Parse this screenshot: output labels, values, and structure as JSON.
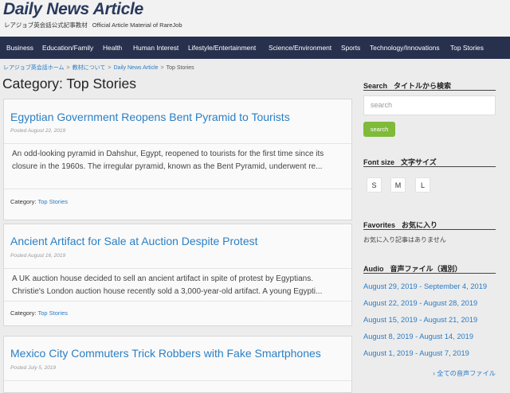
{
  "site": {
    "title": "Daily News Article",
    "subtitle_jp": "レアジョブ英会話公式記事教材",
    "subtitle_en": "Official Article Material of RareJob"
  },
  "nav": {
    "items": [
      "Business",
      "Education/Family",
      "Health",
      "Human Interest",
      "Lifestyle/Entertainment",
      "Science/Environment",
      "Sports",
      "Technology/Innovations",
      "Top Stories"
    ]
  },
  "breadcrumb": {
    "home": "レアジョブ英会話ホーム",
    "materials": "教材について",
    "dna": "Daily News Article",
    "current": "Top Stories",
    "separator": ">"
  },
  "page": {
    "title": "Category: Top Stories"
  },
  "articles": [
    {
      "title": "Egyptian Government Reopens Bent Pyramid to Tourists",
      "date": "Posted August 22, 2019",
      "excerpt": "An odd-looking pyramid in Dahshur, Egypt, reopened to tourists for the first time since its closure in the 1960s. The irregular pyramid, known as the Bent Pyramid, underwent re...",
      "category_label": "Category:",
      "category": "Top Stories"
    },
    {
      "title": "Ancient Artifact for Sale at Auction Despite Protest",
      "date": "Posted August 16, 2019",
      "excerpt": "A UK auction house decided to sell an ancient artifact in spite of protest by Egyptians. Christie's London auction house recently sold a 3,000-year-old artifact. A young Egypti...",
      "category_label": "Category:",
      "category": "Top Stories"
    },
    {
      "title": "Mexico City Commuters Trick Robbers with Fake Smartphones",
      "date": "Posted July 5, 2019"
    }
  ],
  "sidebar": {
    "search": {
      "heading_en": "Search",
      "heading_jp": "タイトルから検索",
      "placeholder": "search",
      "button": "search"
    },
    "fontsize": {
      "heading_en": "Font size",
      "heading_jp": "文字サイズ",
      "options": [
        "S",
        "M",
        "L"
      ]
    },
    "favorites": {
      "heading_en": "Favorites",
      "heading_jp": "お気に入り",
      "empty": "お気に入り記事はありません"
    },
    "audio": {
      "heading_en": "Audio",
      "heading_jp": "音声ファイル（週別）",
      "links": [
        "August 29, 2019 - September 4, 2019",
        "August 22, 2019 - August 28, 2019",
        "August 15, 2019 - August 21, 2019",
        "August 8, 2019 - August 14, 2019",
        "August 1, 2019 - August 7, 2019"
      ],
      "all": "› 全ての音声ファイル"
    }
  },
  "colors": {
    "nav_bg": "#27314d",
    "link": "#2b7bc4",
    "title": "#2b7fc4",
    "button": "#7fba3a"
  }
}
